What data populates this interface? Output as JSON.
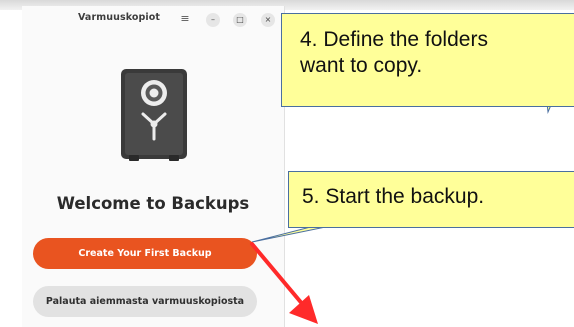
{
  "app": {
    "title": "Varmuuskopiot",
    "welcome_title": "Welcome to Backups",
    "primary_button": "Create Your First Backup",
    "secondary_button": "Palauta aiemmasta varmuuskopiosta"
  },
  "headerbar": {
    "menu_icon": "hamburger-menu-icon",
    "minimize_icon": "minimize-icon",
    "maximize_icon": "maximize-icon",
    "close_icon": "close-icon",
    "menu_glyph": "≡",
    "minimize_glyph": "–",
    "maximize_glyph": "□",
    "close_glyph": "×"
  },
  "icons": {
    "app_icon": "safe-icon"
  },
  "annotations": {
    "callout_4_line1": "4. Define the folders",
    "callout_4_line2": "want to copy.",
    "callout_5": "5. Start the backup."
  },
  "colors": {
    "primary_button_bg": "#e95420",
    "secondary_button_bg": "#e2e2e2",
    "callout_bg": "#ffff99",
    "arrow": "#ff2a2a"
  }
}
